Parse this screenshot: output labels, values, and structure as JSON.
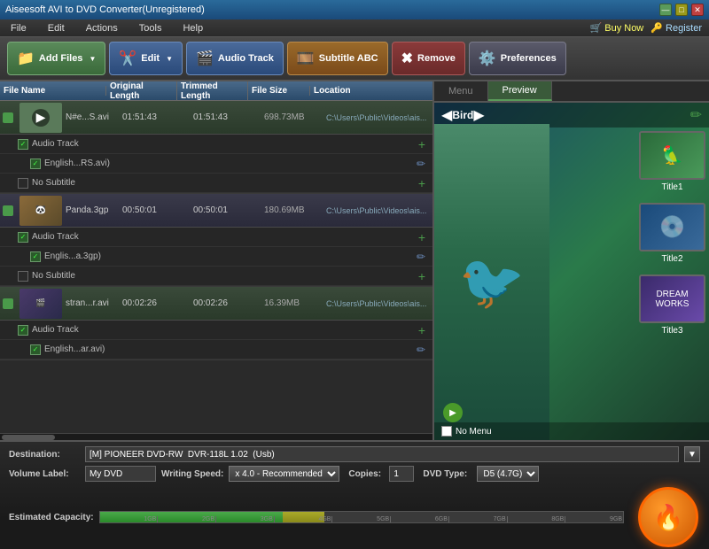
{
  "titleBar": {
    "title": "Aiseesoft AVI to DVD Converter(Unregistered)",
    "minBtn": "—",
    "maxBtn": "□",
    "closeBtn": "✕"
  },
  "menuBar": {
    "items": [
      "File",
      "Edit",
      "Actions",
      "Tools",
      "Help"
    ],
    "buyNow": "Buy Now",
    "register": "Register"
  },
  "toolbar": {
    "addFiles": "Add Files",
    "edit": "Edit",
    "audioTrack": "Audio Track",
    "subtitle": "Subtitle ABC",
    "remove": "Remove",
    "preferences": "Preferences"
  },
  "fileList": {
    "headers": [
      "File Name",
      "Original Length",
      "Trimmed Length",
      "File Size",
      "Location"
    ],
    "files": [
      {
        "name": "N#e...S.avi",
        "original": "01:51:43",
        "trimmed": "01:51:43",
        "size": "698.73MB",
        "location": "C:\\Users\\Public\\Videos\\ais...",
        "audioTrack": "Audio Track",
        "audioSub": "English...RS.avi)",
        "subtitle": "No Subtitle"
      },
      {
        "name": "Panda.3gp",
        "original": "00:50:01",
        "trimmed": "00:50:01",
        "size": "180.69MB",
        "location": "C:\\Users\\Public\\Videos\\ais...",
        "audioTrack": "Audio Track",
        "audioSub": "Englis...a.3gp)",
        "subtitle": "No Subtitle"
      },
      {
        "name": "stran...r.avi",
        "original": "00:02:26",
        "trimmed": "00:02:26",
        "size": "16.39MB",
        "location": "C:\\Users\\Public\\Videos\\ais...",
        "audioTrack": "Audio Track",
        "audioSub": "English...ar.avi)"
      }
    ]
  },
  "rightPanel": {
    "tabs": [
      "Menu",
      "Preview"
    ],
    "activeTab": "Preview",
    "navLabel": "Bird",
    "titles": [
      "Title1",
      "Title2",
      "Title3"
    ],
    "noMenu": "No Menu"
  },
  "bottomPanel": {
    "destinationLabel": "Destination:",
    "destinationValue": "[M] PIONEER DVD-RW  DVR-118L 1.02  (Usb)",
    "volumeLabel": "Volume Label:",
    "volumeValue": "My DVD",
    "writingSpeedLabel": "Writing Speed:",
    "writingSpeedValue": "x 4.0 - Recommended",
    "copiesLabel": "Copies:",
    "copiesValue": "1",
    "dvdTypeLabel": "DVD Type:",
    "dvdTypeValue": "D5 (4.7G)",
    "estimatedCapacityLabel": "Estimated Capacity:",
    "capacityTicks": [
      "1GB",
      "2GB",
      "3GB",
      "4GB",
      "5GB",
      "6GB",
      "7GB",
      "8GB",
      "9GB"
    ]
  }
}
